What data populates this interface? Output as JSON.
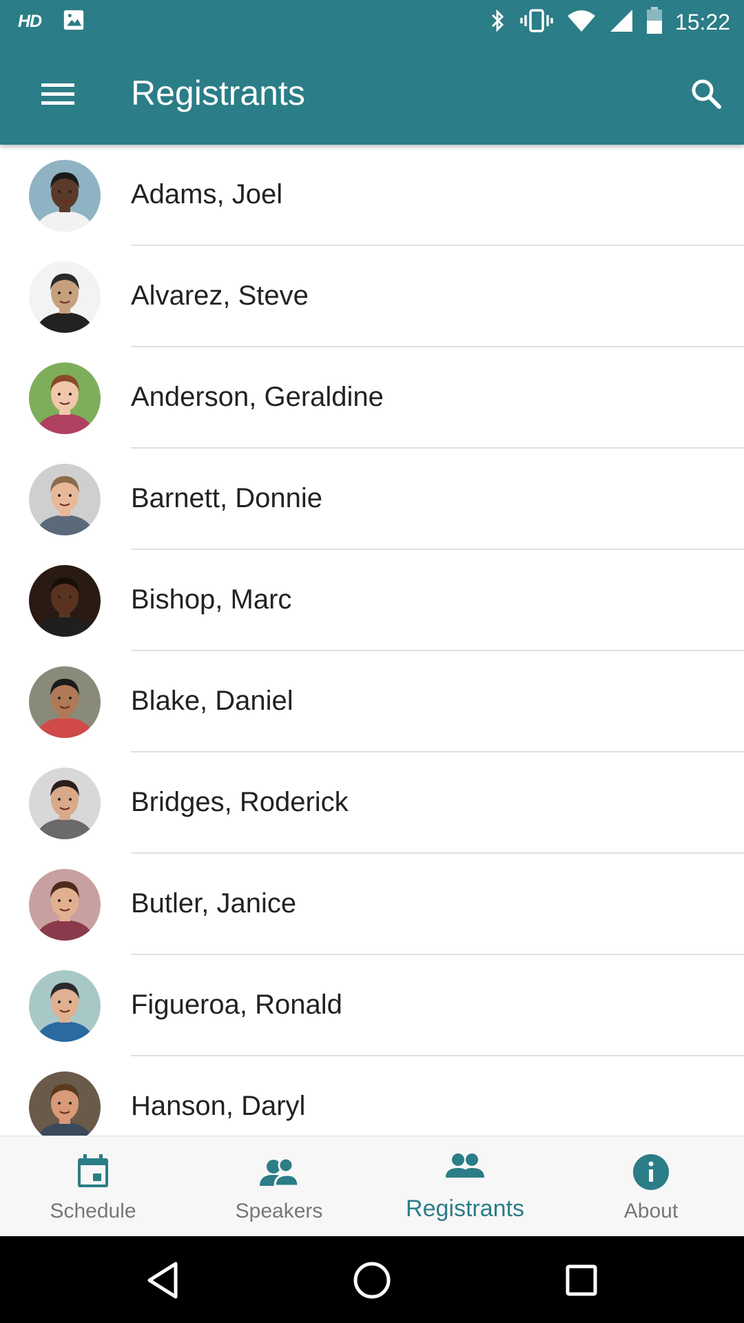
{
  "status_bar": {
    "hd": "HD",
    "time": "15:22"
  },
  "app_bar": {
    "title": "Registrants"
  },
  "registrants": [
    {
      "name": "Adams, Joel",
      "skin": "#5a3a28",
      "hair": "#1a1a1a",
      "bg": "#8fb3c2",
      "shirt": "#f2f2f2"
    },
    {
      "name": "Alvarez, Steve",
      "skin": "#c7a07e",
      "hair": "#2a2a2a",
      "bg": "#f3f3f3",
      "shirt": "#222222"
    },
    {
      "name": "Anderson, Geraldine",
      "skin": "#f0c7aa",
      "hair": "#8a4a2a",
      "bg": "#7fae5a",
      "shirt": "#b04060"
    },
    {
      "name": "Barnett, Donnie",
      "skin": "#e8b898",
      "hair": "#8a6a4a",
      "bg": "#cfcfcf",
      "shirt": "#5a6a7a"
    },
    {
      "name": "Bishop, Marc",
      "skin": "#5a3320",
      "hair": "#1a0f08",
      "bg": "#2a1a14",
      "shirt": "#1f1f1f"
    },
    {
      "name": "Blake, Daniel",
      "skin": "#b07a58",
      "hair": "#1a1a1a",
      "bg": "#8a8a7a",
      "shirt": "#d04a4a"
    },
    {
      "name": "Bridges, Roderick",
      "skin": "#d8a98a",
      "hair": "#2a1f1a",
      "bg": "#d8d8d8",
      "shirt": "#6a6a6a"
    },
    {
      "name": "Butler, Janice",
      "skin": "#e2b090",
      "hair": "#4a2a1a",
      "bg": "#c8a0a0",
      "shirt": "#8a3a4a"
    },
    {
      "name": "Figueroa, Ronald",
      "skin": "#e0b090",
      "hair": "#2a2a2a",
      "bg": "#a8c8c8",
      "shirt": "#2a6aa0"
    },
    {
      "name": "Hanson, Daryl",
      "skin": "#d89a78",
      "hair": "#5a3a20",
      "bg": "#6a5a4a",
      "shirt": "#3a4a5a"
    }
  ],
  "bottom_nav": {
    "items": [
      {
        "label": "Schedule",
        "icon": "calendar-icon"
      },
      {
        "label": "Speakers",
        "icon": "speakers-icon"
      },
      {
        "label": "Registrants",
        "icon": "people-icon",
        "active": true
      },
      {
        "label": "About",
        "icon": "info-icon"
      }
    ]
  },
  "colors": {
    "primary": "#2b7d87",
    "nav_inactive": "#777777",
    "text": "#222222",
    "divider": "#e0e0e0"
  }
}
